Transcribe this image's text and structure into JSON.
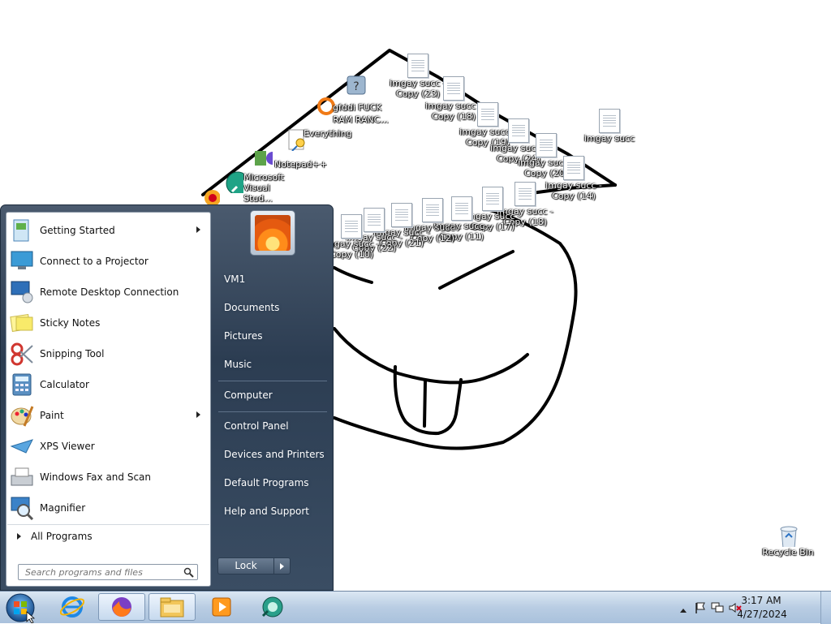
{
  "desktop": {
    "icons": [
      {
        "label": "",
        "kind": "help"
      },
      {
        "label": "gfddi FUCK",
        "kind": "shortcut-orange"
      },
      {
        "label": "RAM RANC...",
        "kind": "shortcut"
      },
      {
        "label": "Everything",
        "kind": "search"
      },
      {
        "label": "Notepad++",
        "kind": "notepad"
      },
      {
        "label": "Microsoft Visual Stud...",
        "kind": "vs"
      },
      {
        "label": "imgay succ - Copy (23)",
        "kind": "doc"
      },
      {
        "label": "imgay succ - Copy (18)",
        "kind": "doc"
      },
      {
        "label": "imgay succ - Copy (19)",
        "kind": "doc"
      },
      {
        "label": "imgay succ - Copy (24)",
        "kind": "doc"
      },
      {
        "label": "imgay succ - Copy (20)",
        "kind": "doc"
      },
      {
        "label": "imgay succ - Copy (14)",
        "kind": "doc"
      },
      {
        "label": "imgay succ",
        "kind": "doc"
      },
      {
        "label": "imgay succ - Copy (18)",
        "kind": "doc"
      },
      {
        "label": "imgay succ - Copy (17)",
        "kind": "doc"
      },
      {
        "label": "imgay succ - Copy (11)",
        "kind": "doc"
      },
      {
        "label": "imgay succ - Copy (12)",
        "kind": "doc"
      },
      {
        "label": "imgay succ - Copy (21)",
        "kind": "doc"
      },
      {
        "label": "imgay succ - Copy (22)",
        "kind": "doc"
      },
      {
        "label": "imgay succ - Copy (10)",
        "kind": "doc"
      }
    ],
    "recycle_bin": "Recycle Bin"
  },
  "start_menu": {
    "programs": [
      {
        "label": "Getting Started",
        "icon": "getting-started-icon",
        "submenu": true
      },
      {
        "label": "Connect to a Projector",
        "icon": "projector-icon",
        "submenu": false
      },
      {
        "label": "Remote Desktop Connection",
        "icon": "remote-desktop-icon",
        "submenu": false
      },
      {
        "label": "Sticky Notes",
        "icon": "sticky-notes-icon",
        "submenu": false
      },
      {
        "label": "Snipping Tool",
        "icon": "snipping-tool-icon",
        "submenu": false
      },
      {
        "label": "Calculator",
        "icon": "calculator-icon",
        "submenu": false
      },
      {
        "label": "Paint",
        "icon": "paint-icon",
        "submenu": true
      },
      {
        "label": "XPS Viewer",
        "icon": "xps-viewer-icon",
        "submenu": false
      },
      {
        "label": "Windows Fax and Scan",
        "icon": "fax-scan-icon",
        "submenu": false
      },
      {
        "label": "Magnifier",
        "icon": "magnifier-icon",
        "submenu": false
      }
    ],
    "all_programs": "All Programs",
    "search_placeholder": "Search programs and files",
    "right_links": {
      "user": "VM1",
      "documents": "Documents",
      "pictures": "Pictures",
      "music": "Music",
      "computer": "Computer",
      "control_panel": "Control Panel",
      "devices": "Devices and Printers",
      "default_programs": "Default Programs",
      "help": "Help and Support"
    },
    "lock_label": "Lock"
  },
  "taskbar": {
    "pinned": [
      "internet-explorer-icon",
      "firefox-icon",
      "file-explorer-icon",
      "media-player-icon",
      "app-icon"
    ],
    "clock_time": "3:17 AM",
    "clock_date": "4/27/2024"
  },
  "colors": {
    "start_menu_dark": "#2c3d52",
    "taskbar": "#b9cde3"
  }
}
